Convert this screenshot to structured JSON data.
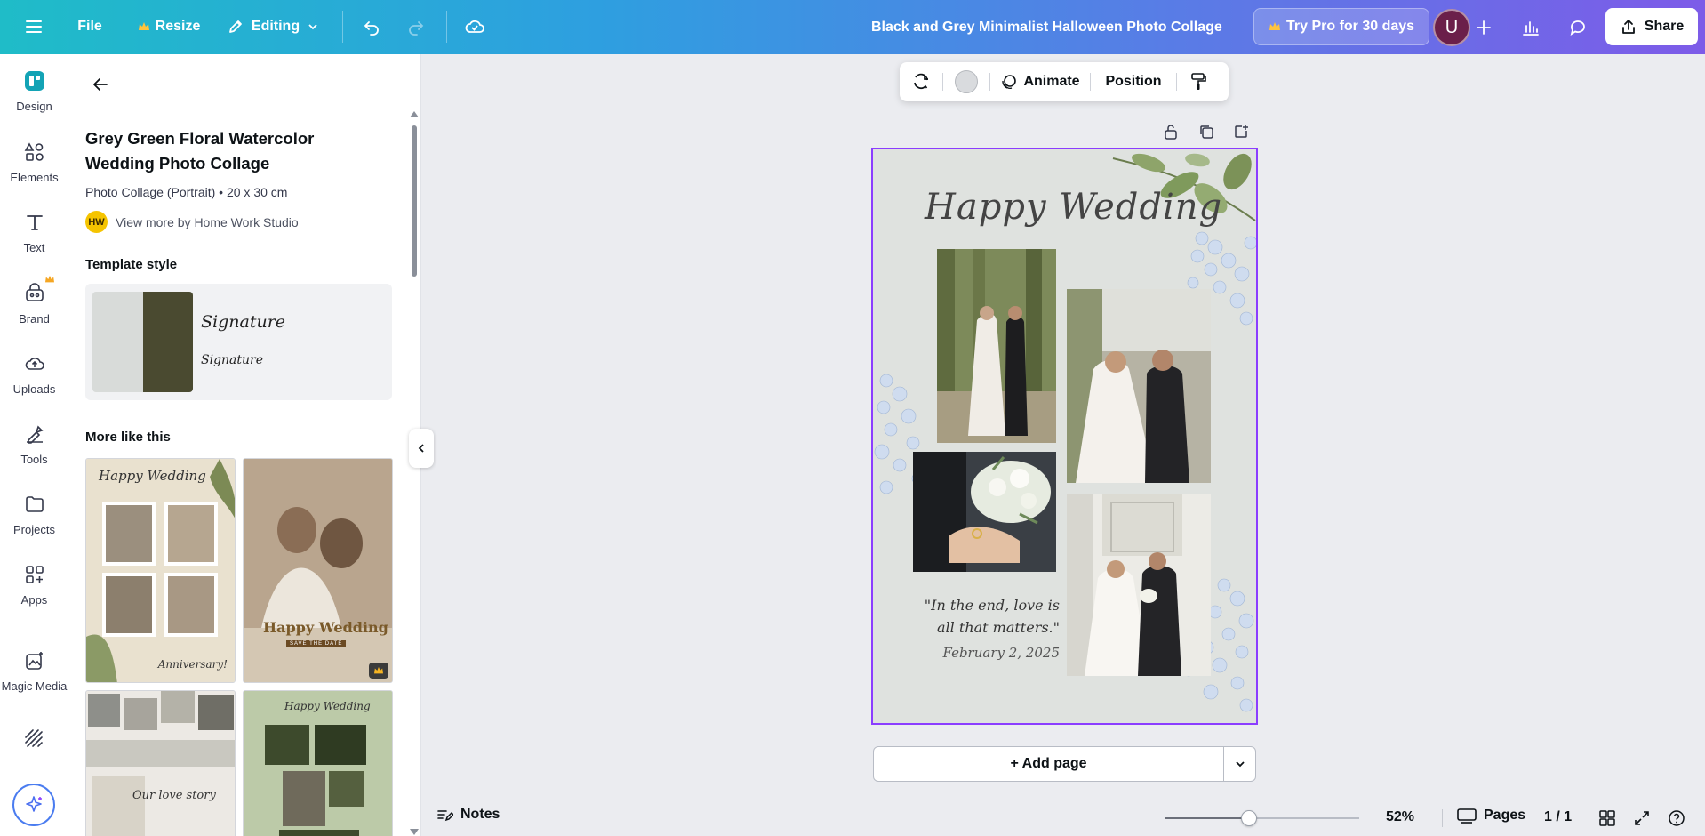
{
  "topbar": {
    "file_label": "File",
    "resize_label": "Resize",
    "editing_label": "Editing",
    "doc_title": "Black and Grey Minimalist Halloween Photo Collage",
    "try_pro_label": "Try Pro for 30 days",
    "avatar_letter": "U",
    "share_label": "Share"
  },
  "rail": {
    "items": [
      {
        "label": "Design",
        "icon": "design-icon"
      },
      {
        "label": "Elements",
        "icon": "elements-icon"
      },
      {
        "label": "Text",
        "icon": "text-icon"
      },
      {
        "label": "Brand",
        "icon": "brand-icon"
      },
      {
        "label": "Uploads",
        "icon": "uploads-icon"
      },
      {
        "label": "Tools",
        "icon": "tools-icon"
      },
      {
        "label": "Projects",
        "icon": "projects-icon"
      },
      {
        "label": "Apps",
        "icon": "apps-icon"
      },
      {
        "label": "Magic Media",
        "icon": "magic-media-icon"
      }
    ]
  },
  "panel": {
    "template_title": "Grey Green Floral Watercolor Wedding Photo Collage",
    "template_meta": "Photo Collage (Portrait) • 20 x 30 cm",
    "author_initials": "HW",
    "author_link": "View more by Home Work Studio",
    "template_style_heading": "Template style",
    "style_font_sample": "Signature",
    "style_colors": [
      "#d8dbd9",
      "#4a4a30"
    ],
    "more_like_this_heading": "More like this",
    "thumbs": [
      {
        "title": "Happy Wedding",
        "footer": "Anniversary!"
      },
      {
        "title": "Happy Wedding",
        "footer": "SAVE THE DATE"
      },
      {
        "title": "Our love story",
        "footer": ""
      },
      {
        "title": "Happy Wedding",
        "footer": ""
      }
    ]
  },
  "context_toolbar": {
    "animate_label": "Animate",
    "position_label": "Position",
    "color_value": "#d9dbde"
  },
  "page": {
    "script_title": "Happy Wedding",
    "quote": "\"In the end, love is all that matters.\"",
    "date": "February 2, 2025",
    "background": "#dfe2df"
  },
  "add_page_label": "+ Add page",
  "bottombar": {
    "notes_label": "Notes",
    "zoom_percent": 52,
    "zoom_label": "52%",
    "pages_label": "Pages",
    "page_count": "1 / 1"
  },
  "colors": {
    "accent": "#8b3dff",
    "topbar_start": "#1fbcc8",
    "topbar_end": "#7d5be8"
  }
}
